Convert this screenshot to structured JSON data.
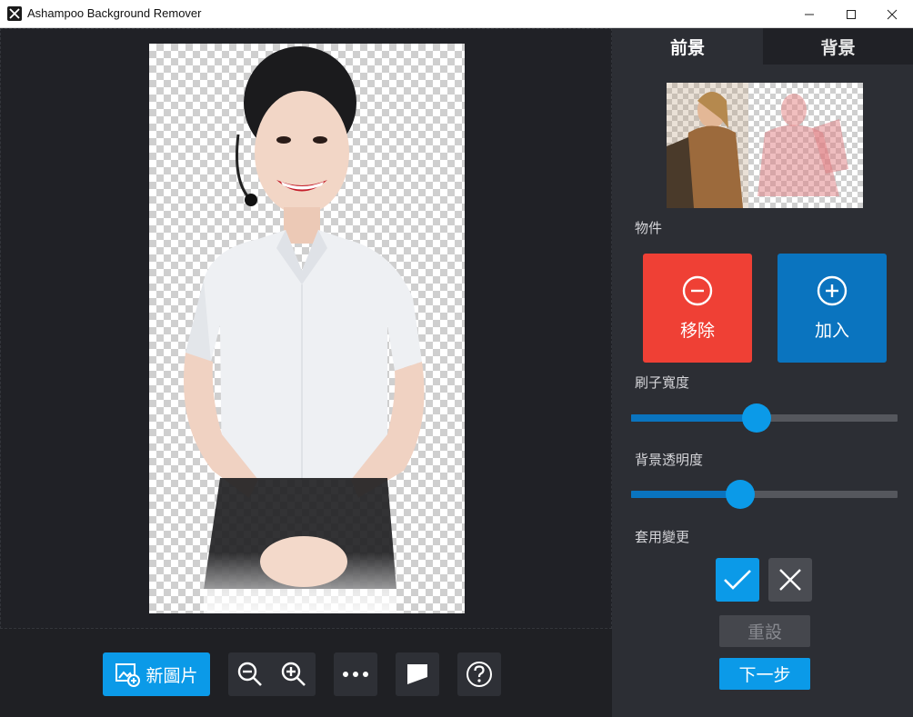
{
  "window": {
    "title": "Ashampoo Background Remover"
  },
  "panel": {
    "tabs": [
      "前景",
      "背景"
    ],
    "active_tab": "前景",
    "objects_label": "物件",
    "remove_label": "移除",
    "add_label": "加入",
    "brush_label": "刷子寬度",
    "brush_value": 0.47,
    "opacity_label": "背景透明度",
    "opacity_value": 0.41,
    "apply_label": "套用變更",
    "reset_label": "重設",
    "next_label": "下一步"
  },
  "toolbar": {
    "new_image_label": "新圖片"
  },
  "colors": {
    "accent": "#0b9ae8",
    "remove": "#ef4035",
    "add": "#0a74bf"
  },
  "icons": [
    "close-icon",
    "minimize-icon",
    "maximize-icon",
    "minus-circle-icon",
    "plus-circle-icon",
    "zoom-out-icon",
    "zoom-in-icon",
    "more-icon",
    "compare-icon",
    "help-icon",
    "check-icon",
    "x-icon",
    "new-image-icon"
  ]
}
